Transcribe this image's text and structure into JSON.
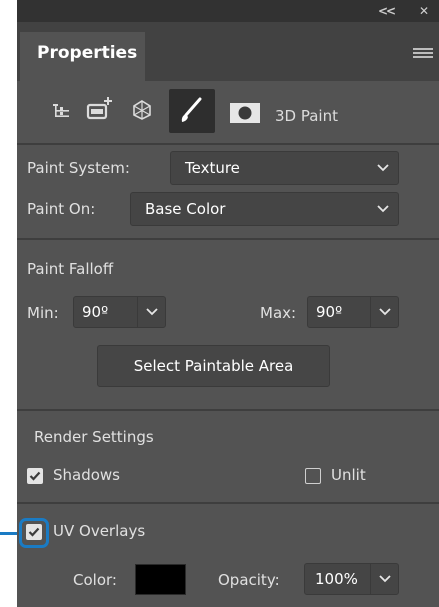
{
  "panel": {
    "title": "Properties",
    "colors": {
      "bg": "#535353",
      "callout": "#1a7bc4"
    }
  },
  "icons": [
    {
      "name": "scene-icon",
      "active": false
    },
    {
      "name": "mesh-icon",
      "active": false
    },
    {
      "name": "coordinates-icon",
      "active": false
    },
    {
      "name": "paint-brush-icon",
      "active": true
    },
    {
      "name": "mask-icon",
      "active": false
    }
  ],
  "mode_label": "3D Paint",
  "paint": {
    "system_label": "Paint System:",
    "system_value": "Texture",
    "on_label": "Paint On:",
    "on_value": "Base Color"
  },
  "falloff": {
    "title": "Paint Falloff",
    "min_label": "Min:",
    "min_value": "90º",
    "max_label": "Max:",
    "max_value": "90º"
  },
  "select_button": "Select Paintable Area",
  "render": {
    "title": "Render Settings",
    "shadows_label": "Shadows",
    "shadows_checked": true,
    "unlit_label": "Unlit",
    "unlit_checked": false
  },
  "uv": {
    "label": "UV Overlays",
    "checked": true,
    "color_label": "Color:",
    "color_value": "#000000",
    "opacity_label": "Opacity:",
    "opacity_value": "100%"
  }
}
